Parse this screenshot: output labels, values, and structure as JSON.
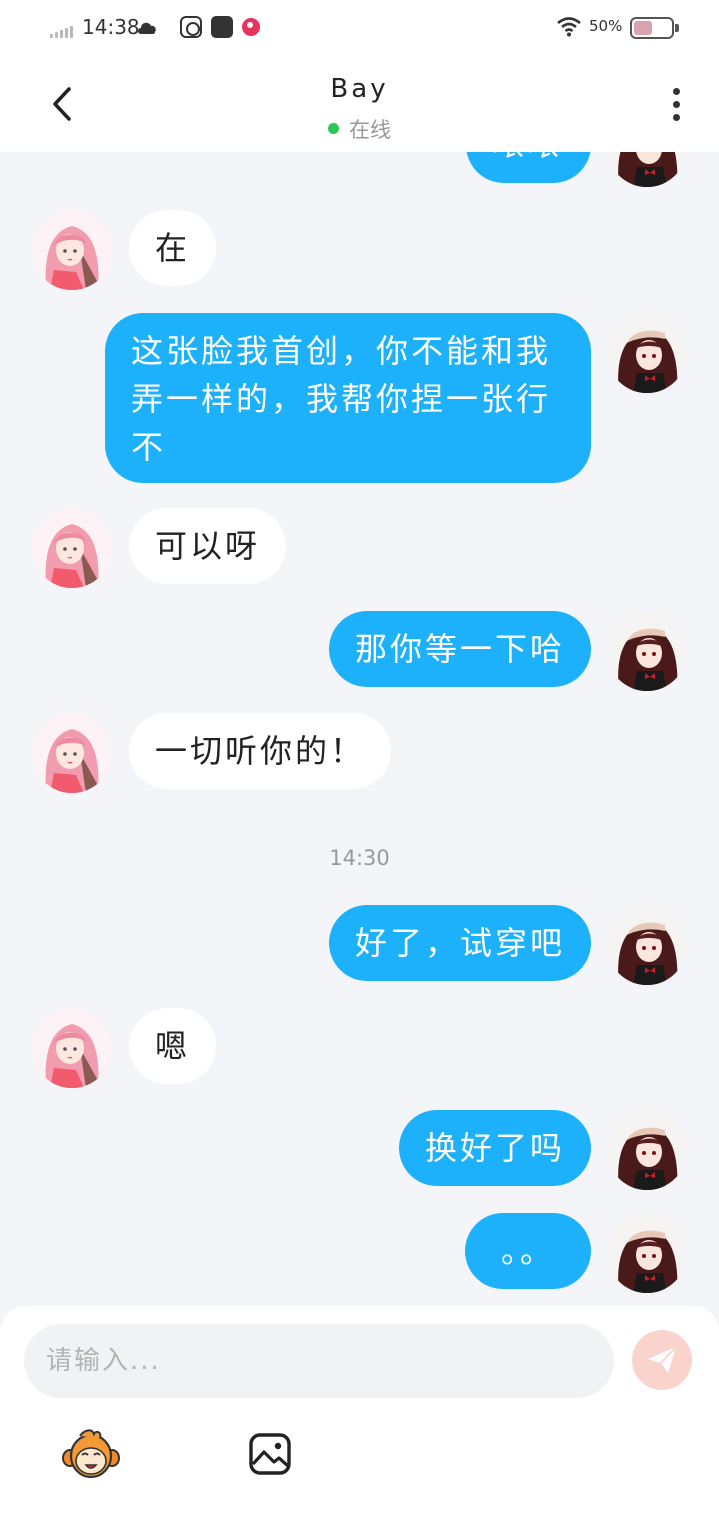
{
  "status_bar": {
    "time": "14:38",
    "battery": "50%",
    "battery_level": 0.5
  },
  "header": {
    "title": "Bay",
    "status": "在线",
    "status_color": "#2ec655"
  },
  "messages": {
    "partial_top": "哝哝",
    "m1": "在",
    "m2": "这张脸我首创，你不能和我弄一样的，我帮你捏一张行不",
    "m3": "可以呀",
    "m4": "那你等一下哈",
    "m5": "一切听你的！",
    "time_separator": "14:30",
    "m6": "好了，试穿吧",
    "m7": "嗯",
    "m8": "换好了吗",
    "m9": "。。"
  },
  "composer": {
    "placeholder": "请输入..."
  },
  "colors": {
    "my_bubble": "#1eb1fb",
    "their_bubble": "#ffffff",
    "background": "#f4f5f8",
    "send_button": "#fad4cc"
  },
  "icons": {
    "back": "chevron-left-icon",
    "more": "more-vertical-icon",
    "send": "paper-plane-icon",
    "emoji": "monkey-emoji-icon",
    "image": "image-icon"
  }
}
